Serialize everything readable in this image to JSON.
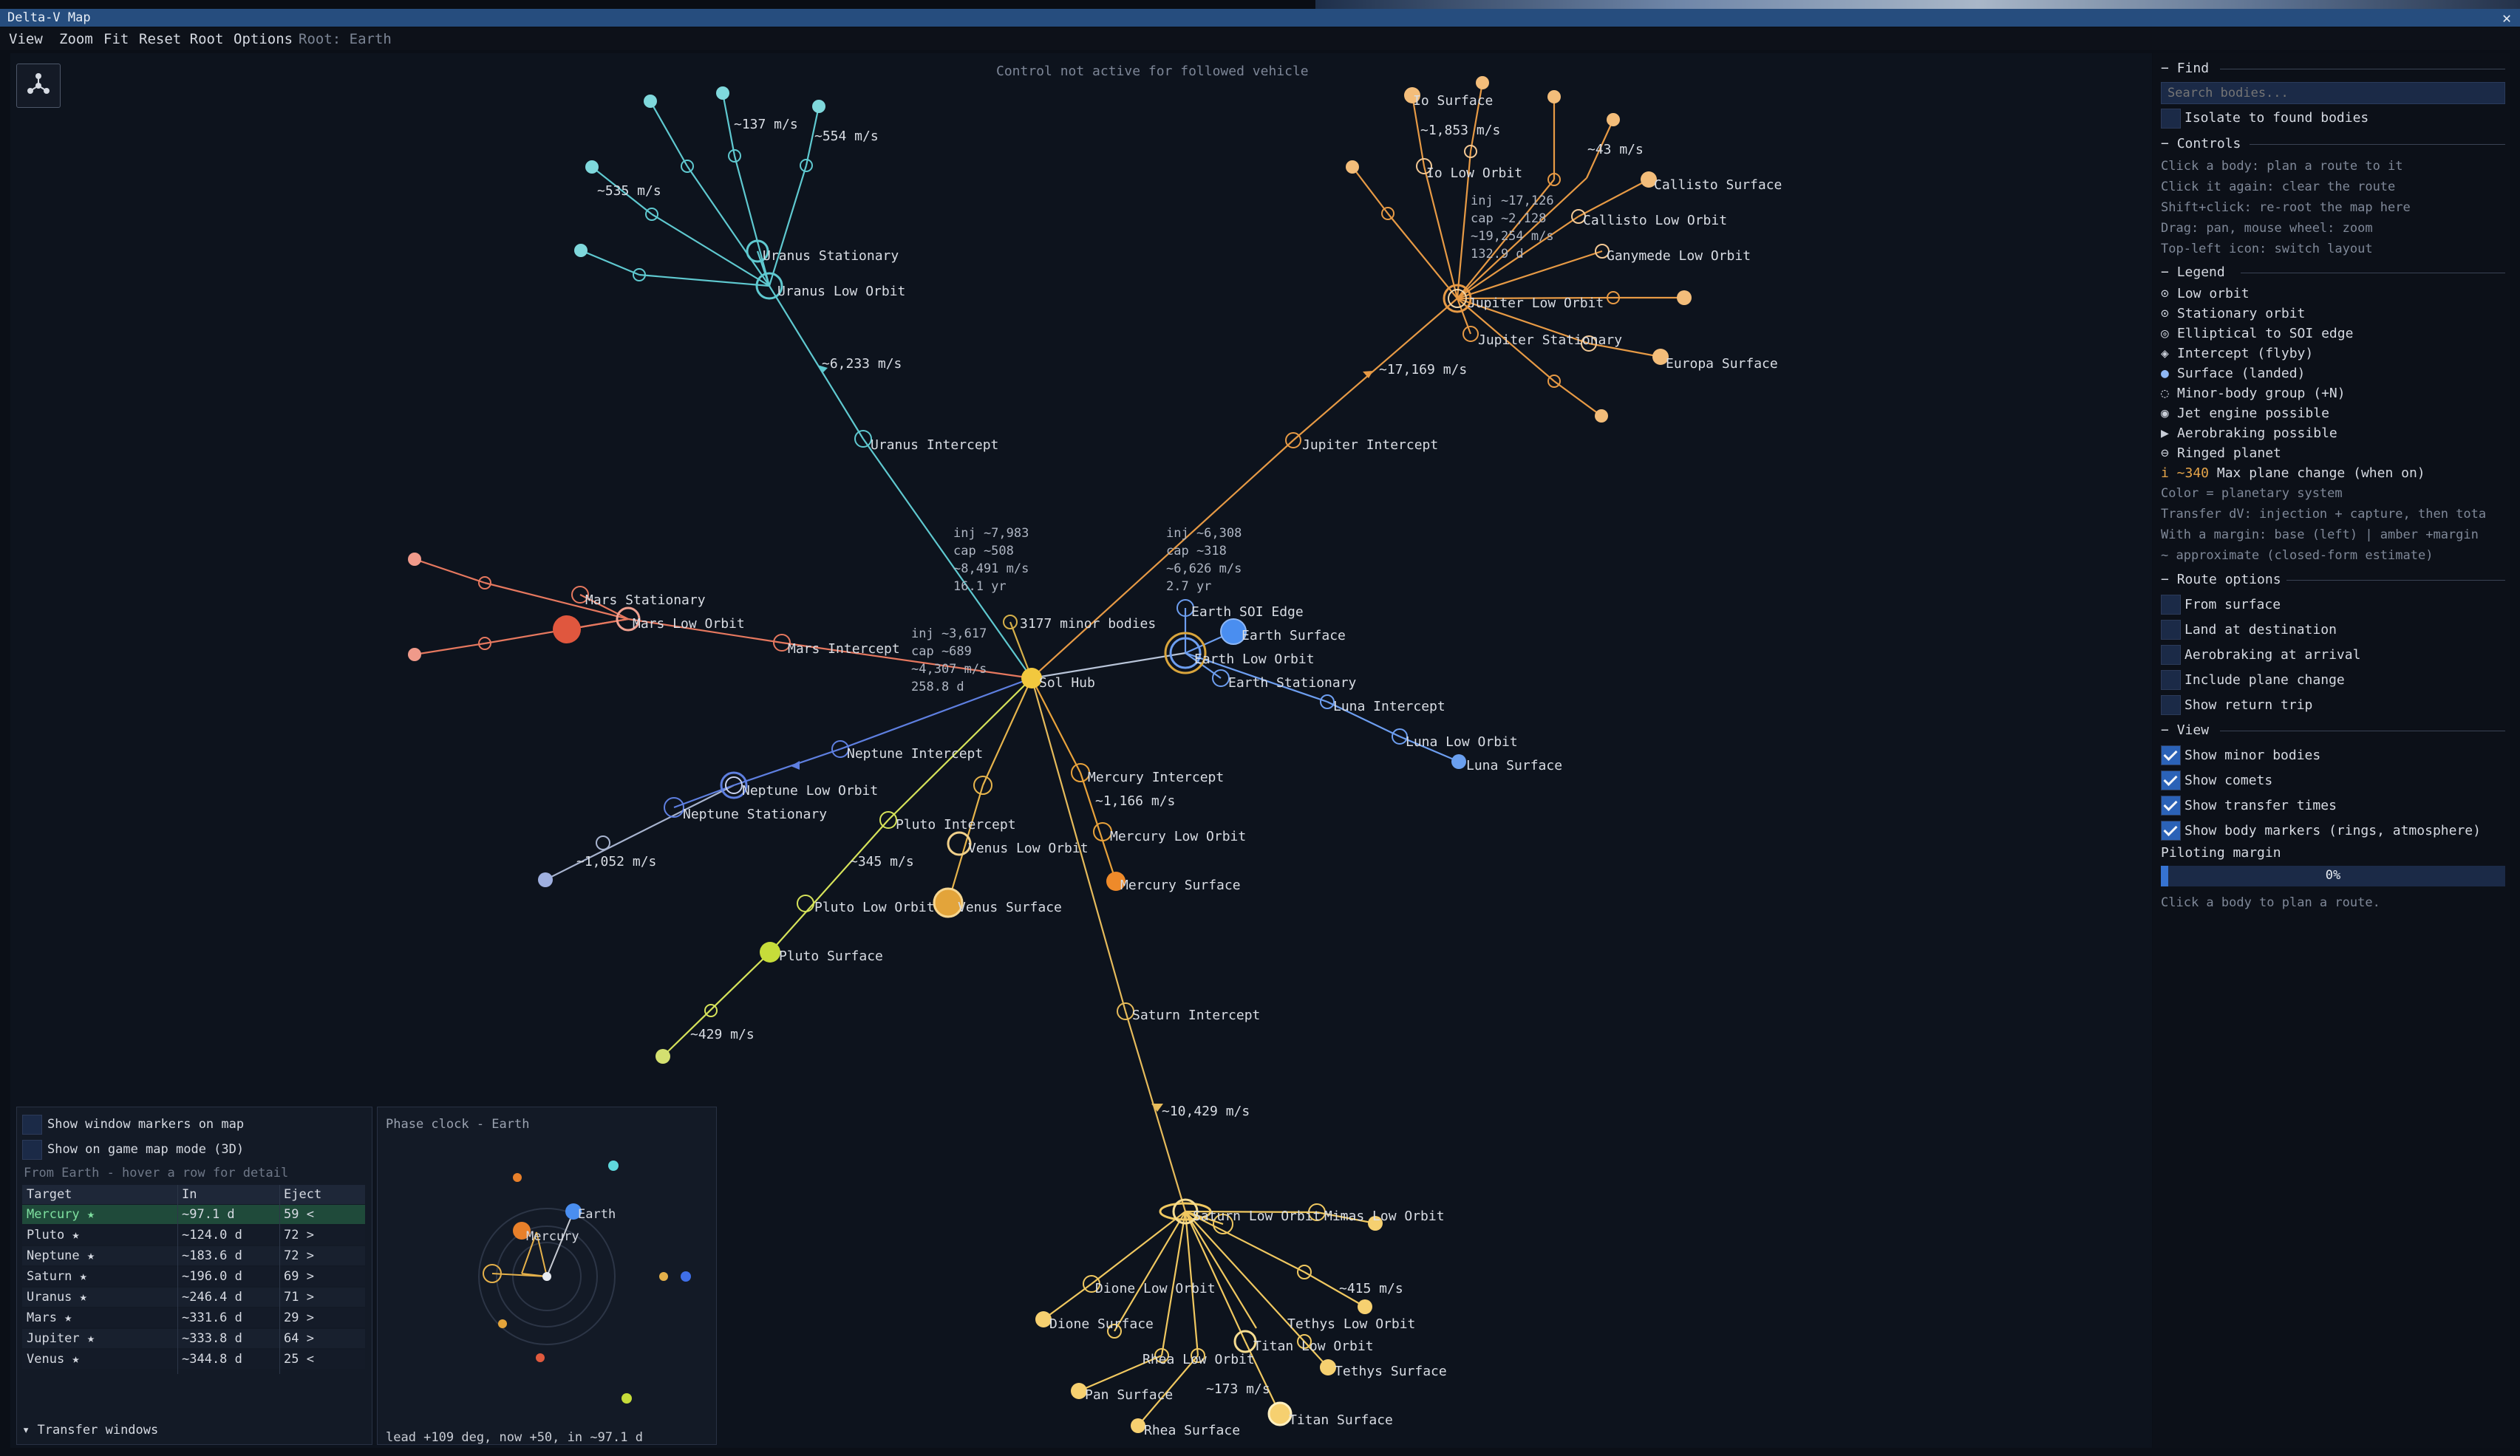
{
  "window": {
    "title": "Delta-V Map",
    "close_icon": "close-icon"
  },
  "menu": {
    "items": [
      "View",
      "Zoom",
      "Fit",
      "Reset Root",
      "Options"
    ],
    "root_label": "Root: Earth"
  },
  "map": {
    "notice": "Control not active for followed vehicle",
    "layout_icon": "layout-toggle-icon",
    "labels": {
      "io_surface": "Io Surface",
      "io_low_orbit": "Io Low Orbit",
      "callisto_surface": "Callisto Surface",
      "callisto_low_orbit": "Callisto Low Orbit",
      "ganymede_low_orbit": "Ganymede Low Orbit",
      "jupiter_low_orbit": "Jupiter Low Orbit",
      "jupiter_stationary": "Jupiter Stationary",
      "europa_surface": "Europa Surface",
      "jupiter_intercept": "Jupiter Intercept",
      "uranus_stationary": "Uranus Stationary",
      "uranus_low_orbit": "Uranus Low Orbit",
      "uranus_intercept": "Uranus Intercept",
      "mars_stationary": "Mars Stationary",
      "mars_low_orbit": "Mars Low Orbit",
      "mars_intercept": "Mars Intercept",
      "minor_bodies": "3177 minor bodies",
      "sol_hub": "Sol Hub",
      "earth_soi_edge": "Earth SOI Edge",
      "earth_surface": "Earth Surface",
      "earth_low_orbit": "Earth Low Orbit",
      "earth_stationary": "Earth Stationary",
      "luna_intercept": "Luna Intercept",
      "luna_low_orbit": "Luna Low Orbit",
      "luna_surface": "Luna Surface",
      "neptune_intercept": "Neptune Intercept",
      "neptune_low_orbit": "Neptune Low Orbit",
      "neptune_stationary": "Neptune Stationary",
      "mercury_intercept": "Mercury Intercept",
      "mercury_low_orbit": "Mercury Low Orbit",
      "mercury_surface": "Mercury Surface",
      "pluto_intercept": "Pluto Intercept",
      "venus_low_orbit": "Venus Low Orbit",
      "venus_surface": "Venus Surface",
      "pluto_low_orbit": "Pluto Low Orbit",
      "pluto_surface": "Pluto Surface",
      "saturn_intercept": "Saturn Intercept",
      "saturn_low_orbit": "Saturn Low Orbit",
      "mimas_low_orbit": "Mimas Low Orbit",
      "dione_low_orbit": "Dione Low Orbit",
      "dione_surface": "Dione Surface",
      "tethys_low_orbit": "Tethys Low Orbit",
      "titan_low_orbit": "Titan Low Orbit",
      "tethys_surface": "Tethys Surface",
      "rhea_low_orbit": "Rhea Low Orbit",
      "pan_surface": "Pan Surface",
      "titan_surface": "Titan Surface",
      "rhea_surface": "Rhea Surface"
    },
    "dv": {
      "d137": "~137 m/s",
      "d554": "~554 m/s",
      "d535": "~535 m/s",
      "d6233": "~6,233 m/s",
      "d1853": "~1,853 m/s",
      "d43": "~43 m/s",
      "d17169": "~17,169 m/s",
      "d1166": "~1,166 m/s",
      "d345": "~345 m/s",
      "d1052": "~1,052 m/s",
      "d429": "~429 m/s",
      "d10429": "~10,429 m/s",
      "d415": "~415 m/s",
      "d173": "~173 m/s"
    },
    "info": {
      "uranus": "inj ~7,983\ncap ~508\n~8,491 m/s\n16.1 yr",
      "jupiter_top": "inj ~17,126\ncap ~2,128\n~19,254 m/s\n132.9 d",
      "jupiter": "inj ~6,308\ncap ~318\n~6,626 m/s\n2.7 yr",
      "mars": "inj ~3,617\ncap ~689\n~4,307 m/s\n258.8 d"
    }
  },
  "find": {
    "title": "Find",
    "search_placeholder": "Search bodies...",
    "isolate_label": "Isolate to found bodies"
  },
  "controls": {
    "title": "Controls",
    "lines": [
      "Click a body: plan a route to it",
      "Click it again: clear the route",
      "Shift+click: re-root the map here",
      "Drag: pan,  mouse wheel: zoom",
      "Top-left icon: switch layout"
    ]
  },
  "legend": {
    "title": "Legend",
    "items": [
      {
        "icon": "low-orbit-icon",
        "label": "Low orbit"
      },
      {
        "icon": "stationary-orbit-icon",
        "label": "Stationary orbit"
      },
      {
        "icon": "elliptical-orbit-icon",
        "label": "Elliptical to SOI edge"
      },
      {
        "icon": "intercept-icon",
        "label": "Intercept (flyby)"
      },
      {
        "icon": "surface-icon",
        "label": "Surface (landed)"
      },
      {
        "icon": "minor-body-group-icon",
        "label": "Minor-body group (+N)"
      },
      {
        "icon": "jet-engine-icon",
        "label": "Jet engine possible"
      },
      {
        "icon": "aerobraking-icon",
        "label": "Aerobraking possible"
      },
      {
        "icon": "ringed-planet-icon",
        "label": "Ringed planet"
      },
      {
        "icon": "plane-change-icon",
        "prefix": "i ~340",
        "label": "Max plane change (when on)"
      }
    ],
    "notes": [
      "Color = planetary system",
      "Transfer dV: injection + capture, then tota",
      "With a margin: base (left) | amber +margin",
      "~  approximate (closed-form estimate)"
    ]
  },
  "route_options": {
    "title": "Route options",
    "items": [
      {
        "label": "From surface",
        "checked": false
      },
      {
        "label": "Land at destination",
        "checked": false
      },
      {
        "label": "Aerobraking at arrival",
        "checked": false
      },
      {
        "label": "Include plane change",
        "checked": false
      },
      {
        "label": "Show return trip",
        "checked": false
      }
    ]
  },
  "view": {
    "title": "View",
    "items": [
      {
        "label": "Show minor bodies",
        "checked": true
      },
      {
        "label": "Show comets",
        "checked": true
      },
      {
        "label": "Show transfer times",
        "checked": true
      },
      {
        "label": "Show body markers (rings, atmosphere)",
        "checked": true
      }
    ],
    "piloting_margin_label": "Piloting margin",
    "piloting_margin_value": "0%",
    "piloting_margin_fraction": 0.0,
    "hint": "Click a body to plan a route."
  },
  "transfer_windows": {
    "show_markers_label": "Show window markers on map",
    "show_game_map_label": "Show on game map mode (3D)",
    "subtitle": "From Earth - hover a row for detail",
    "headers": [
      "Target",
      "In",
      "Eject"
    ],
    "rows": [
      [
        "Mercury ★",
        "~97.1 d",
        "59 <"
      ],
      [
        "Pluto ★",
        "~124.0 d",
        "72 >"
      ],
      [
        "Neptune ★",
        "~183.6 d",
        "72 >"
      ],
      [
        "Saturn ★",
        "~196.0 d",
        "69 >"
      ],
      [
        "Uranus ★",
        "~246.4 d",
        "71 >"
      ],
      [
        "Mars ★",
        "~331.6 d",
        "29 >"
      ],
      [
        "Jupiter ★",
        "~333.8 d",
        "64 >"
      ],
      [
        "Venus ★",
        "~344.8 d",
        "25 <"
      ]
    ],
    "footer": "Transfer windows"
  },
  "phase_clock": {
    "title": "Phase clock - Earth",
    "earth_label": "Earth",
    "mercury_label": "Mercury",
    "status": "lead +109 deg, now +50, in ~97.1 d"
  }
}
